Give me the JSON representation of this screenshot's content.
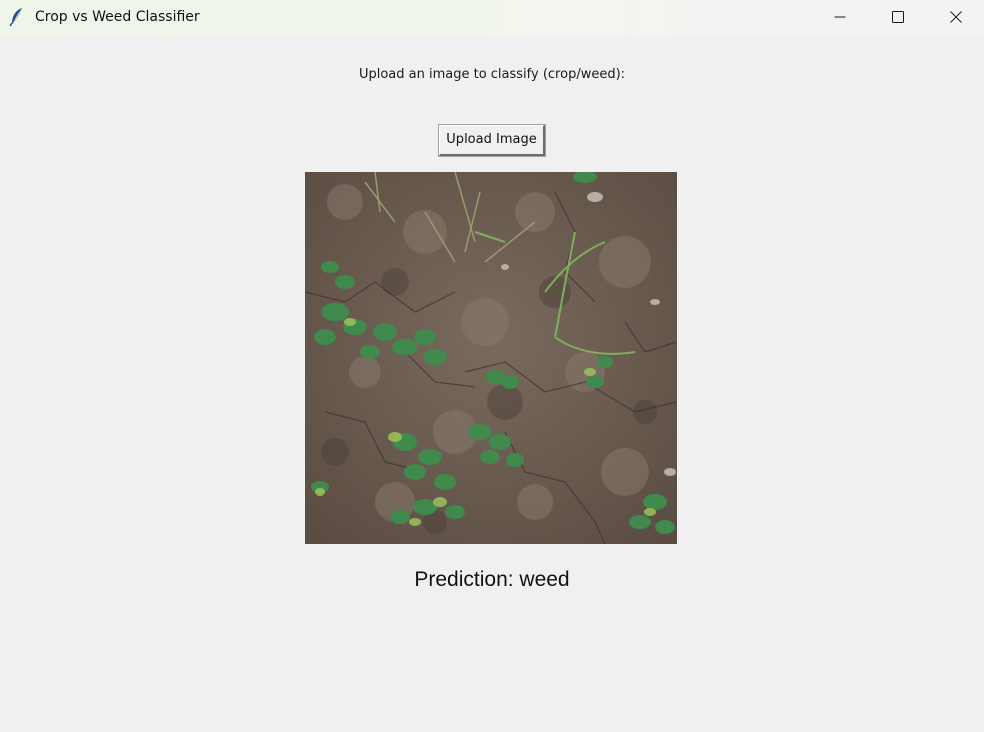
{
  "window": {
    "title": "Crop vs Weed Classifier",
    "icon": "feather-icon",
    "controls": {
      "minimize": "minimize-icon",
      "maximize": "maximize-icon",
      "close": "close-icon"
    }
  },
  "main": {
    "prompt": "Upload an image to classify (crop/weed):",
    "upload_button_label": "Upload Image",
    "image_description": "field-photo",
    "prediction_text": "Prediction: weed"
  },
  "colors": {
    "background": "#f0f0f0",
    "soil": "#6d5e53",
    "leaf": "#3f8a4c"
  }
}
